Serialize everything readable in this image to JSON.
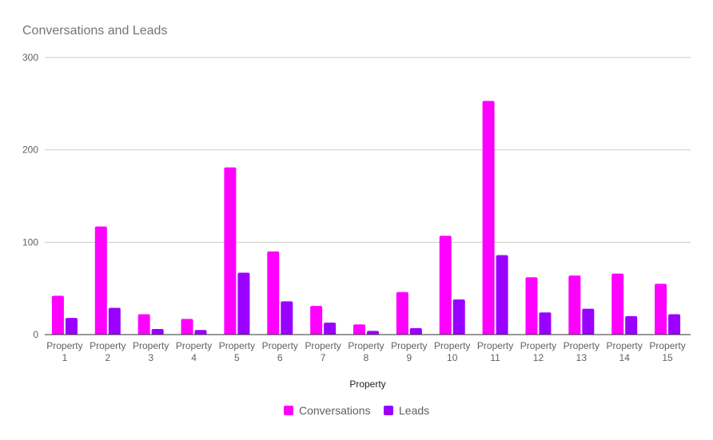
{
  "chart_data": {
    "type": "bar",
    "title": "Conversations and Leads",
    "xlabel": "Property",
    "ylabel": "",
    "ylim": [
      0,
      300
    ],
    "yticks": [
      0,
      100,
      200,
      300
    ],
    "grid": true,
    "legend_position": "bottom",
    "categories": [
      "Property 1",
      "Property 2",
      "Property 3",
      "Property 4",
      "Property 5",
      "Property 6",
      "Property 7",
      "Property 8",
      "Property 9",
      "Property 10",
      "Property 11",
      "Property 12",
      "Property 13",
      "Property 14",
      "Property 15"
    ],
    "series": [
      {
        "name": "Conversations",
        "color": "#ff00ff",
        "values": [
          42,
          117,
          22,
          17,
          181,
          90,
          31,
          11,
          46,
          107,
          253,
          62,
          64,
          66,
          55
        ]
      },
      {
        "name": "Leads",
        "color": "#9900ff",
        "values": [
          18,
          29,
          6,
          5,
          67,
          36,
          13,
          4,
          7,
          38,
          86,
          24,
          28,
          20,
          22
        ]
      }
    ]
  }
}
